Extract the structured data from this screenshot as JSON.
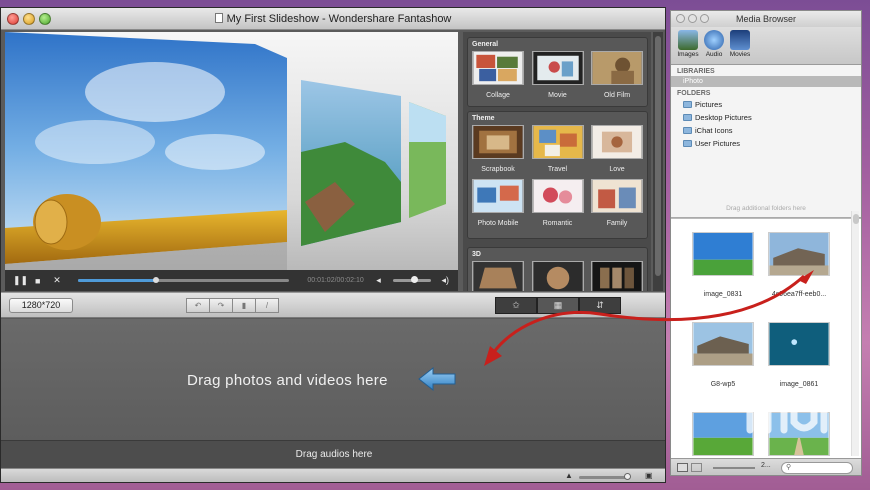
{
  "app": {
    "title": "My First Slideshow - Wondershare Fantashow",
    "resolution": "1280*720",
    "time": "00:01:02/00:02:10",
    "playback_progress": 0.37,
    "volume_level": 0.55
  },
  "templates": {
    "sections": [
      {
        "header": "General",
        "items": [
          {
            "label": "Collage"
          },
          {
            "label": "Movie"
          },
          {
            "label": "Old Film"
          }
        ]
      },
      {
        "header": "Theme",
        "items": [
          {
            "label": "Scrapbook"
          },
          {
            "label": "Travel"
          },
          {
            "label": "Love"
          },
          {
            "label": "Photo Mobile"
          },
          {
            "label": "Romantic"
          },
          {
            "label": "Family"
          }
        ]
      },
      {
        "header": "3D",
        "items": []
      }
    ]
  },
  "edit_toolbar": {
    "icons": [
      "rotate-left-icon",
      "rotate-right-icon",
      "delete-icon",
      "edit-icon"
    ]
  },
  "mode_buttons": [
    {
      "icon": "star-icon",
      "symbol": "✩"
    },
    {
      "icon": "film-icon",
      "symbol": "▦"
    },
    {
      "icon": "export-icon",
      "symbol": "⇵"
    }
  ],
  "drop": {
    "photos_text": "Drag photos and videos here",
    "audios_text": "Drag audios here"
  },
  "media_browser": {
    "title": "Media Browser",
    "tabs": [
      {
        "label": "Images",
        "icon": "images-icon"
      },
      {
        "label": "Audio",
        "icon": "audio-icon"
      },
      {
        "label": "Movies",
        "icon": "movies-icon"
      }
    ],
    "libraries_header": "LIBRARIES",
    "library": "iPhoto",
    "folders_header": "FOLDERS",
    "folders": [
      "Pictures",
      "Desktop Pictures",
      "iChat Icons",
      "User Pictures"
    ],
    "drag_folders_text": "Drag additional folders here",
    "photos": [
      {
        "name": "image_0831"
      },
      {
        "name": "4c96ea7ff-eeb0..."
      },
      {
        "name": "G8-wp5"
      },
      {
        "name": "image_0861"
      }
    ],
    "zoom_value": "2...",
    "search_icon": "search-icon"
  },
  "watermark": "mu",
  "colors": {
    "accent": "#4f9bd9",
    "arrow": "#c8201c",
    "desktop": "#a25fa0"
  }
}
